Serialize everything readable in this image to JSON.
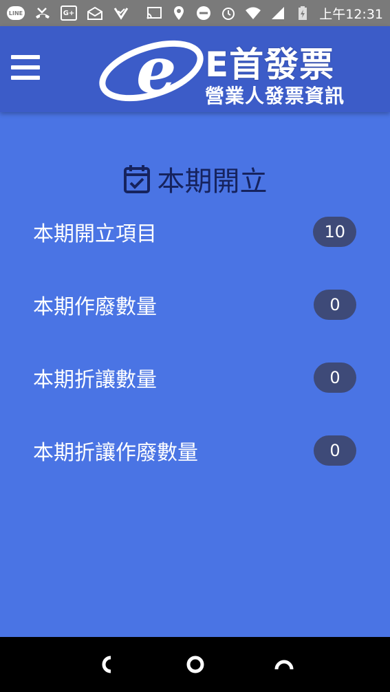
{
  "status_bar": {
    "line_label": "LINE",
    "gplus_label": "G+",
    "time": "上午12:31"
  },
  "header": {
    "logo_letter": "e",
    "title": "E首發票",
    "subtitle": "營業人發票資訊"
  },
  "section": {
    "title": "本期開立"
  },
  "stats": [
    {
      "label": "本期開立項目",
      "value": "10"
    },
    {
      "label": "本期作廢數量",
      "value": "0"
    },
    {
      "label": "本期折讓數量",
      "value": "0"
    },
    {
      "label": "本期折讓作廢數量",
      "value": "0"
    }
  ],
  "colors": {
    "background": "#4a74e4",
    "header": "#3c5cc8",
    "badge": "#3e4a78",
    "title_text": "#16235e"
  }
}
